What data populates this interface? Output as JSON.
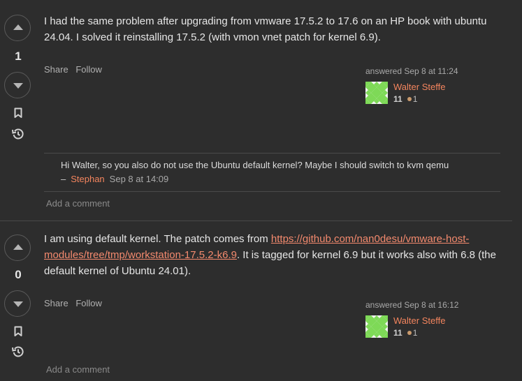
{
  "answers": [
    {
      "votes": "1",
      "body": "I had the same problem after upgrading from vmware 17.5.2 to 17.6 on an HP book with ubuntu 24.04. I solved it reinstalling 17.5.2 (with vmon vnet patch for kernel 6.9).",
      "share_label": "Share",
      "follow_label": "Follow",
      "answered": "answered Sep 8 at 11:24",
      "user_name": "Walter Steffe",
      "reputation": "11",
      "bronze_badges": "1",
      "comments": [
        {
          "text": "Hi Walter, so you also do not use the Ubuntu default kernel? Maybe I should switch to kvm qemu",
          "dash": "–",
          "user": "Stephan",
          "date": "Sep 8 at 14:09"
        }
      ],
      "add_comment": "Add a comment"
    },
    {
      "votes": "0",
      "body_before": "I am using default kernel. The patch comes from ",
      "link": "https://github.com/nan0desu/vmware-host-modules/tree/tmp/workstation-17.5.2-k6.9",
      "body_after": ". It is tagged for kernel 6.9 but it works also with 6.8 (the default kernel of Ubuntu 24.01).",
      "share_label": "Share",
      "follow_label": "Follow",
      "answered": "answered Sep 8 at 16:12",
      "user_name": "Walter Steffe",
      "reputation": "11",
      "bronze_badges": "1",
      "add_comment": "Add a comment"
    }
  ],
  "colors": {
    "accent": "#f4855e",
    "link": "#f48a6e",
    "background": "#2d2d2d",
    "avatar_green": "#7ed957"
  },
  "icons": [
    "upvote-icon",
    "downvote-icon",
    "bookmark-icon",
    "history-icon",
    "identicon-avatar"
  ]
}
